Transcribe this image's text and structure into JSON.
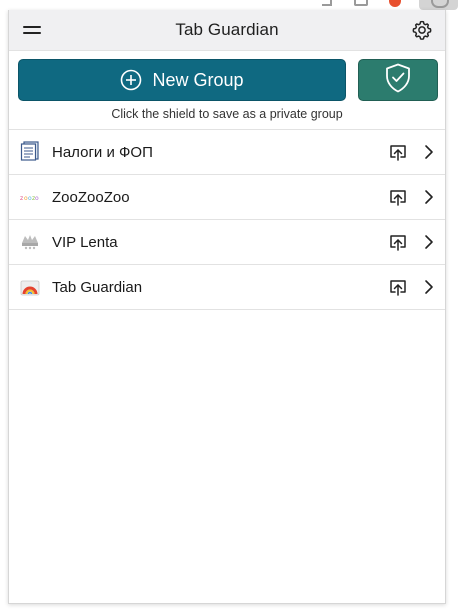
{
  "header": {
    "title": "Tab Guardian",
    "menu_icon": "hamburger-menu-icon",
    "settings_icon": "gear-icon"
  },
  "actions": {
    "new_group_label": "New Group",
    "new_group_icon": "plus-circle-icon",
    "private_icon": "shield-check-icon",
    "hint": "Click the shield to save as a private group"
  },
  "groups": [
    {
      "name": "Налоги и ФОП",
      "icon": "document-favicon"
    },
    {
      "name": "ZooZooZoo",
      "icon": "zoo-favicon"
    },
    {
      "name": "VIP Lenta",
      "icon": "vip-lenta-favicon"
    },
    {
      "name": "Tab Guardian",
      "icon": "tab-guardian-favicon"
    }
  ],
  "colors": {
    "primary": "#0f6981",
    "shield": "#2c7c6e",
    "header_bg": "#f0f0f2"
  }
}
